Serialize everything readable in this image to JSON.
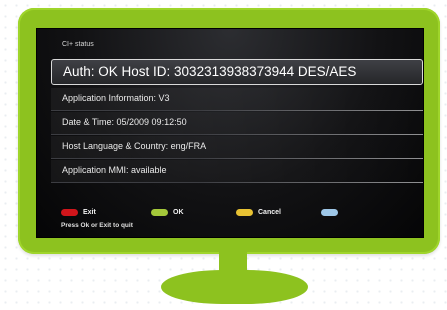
{
  "screen": {
    "title": "CI+ status",
    "rows": [
      {
        "label": "Auth: OK Host ID: 3032313938373944 DES/AES"
      },
      {
        "label": "Application Information: V3"
      },
      {
        "label": "Date & Time: 05/2009 09:12:50"
      },
      {
        "label": "Host Language & Country: eng/FRA"
      },
      {
        "label": "Application MMI: available"
      }
    ],
    "legend": [
      {
        "label": "Exit",
        "color": "#d0151b"
      },
      {
        "label": "OK",
        "color": "#a4c83a"
      },
      {
        "label": "Cancel",
        "color": "#e8c233"
      },
      {
        "label": "",
        "color": "#9ec7e8"
      }
    ],
    "footer": "Press Ok or Exit to quit"
  },
  "colors": {
    "monitor_green": "#8dc21f",
    "screen_bg": "#121214",
    "highlight_border": "#d9d9d9"
  }
}
